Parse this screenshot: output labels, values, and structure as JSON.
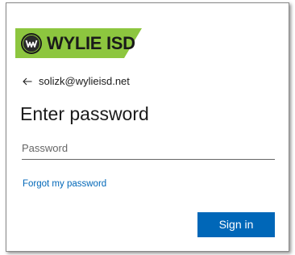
{
  "brand": {
    "name": "WYLIE ISD",
    "banner_color": "#8dc63f",
    "emblem_icon": "wylie-isd-emblem-icon"
  },
  "identity": {
    "back_icon": "arrow-left-icon",
    "email": "solizk@wylieisd.net"
  },
  "title": "Enter password",
  "password_field": {
    "placeholder": "Password",
    "value": ""
  },
  "forgot_link": "Forgot my password",
  "sign_in_button": {
    "label": "Sign in",
    "color": "#0067b8"
  }
}
